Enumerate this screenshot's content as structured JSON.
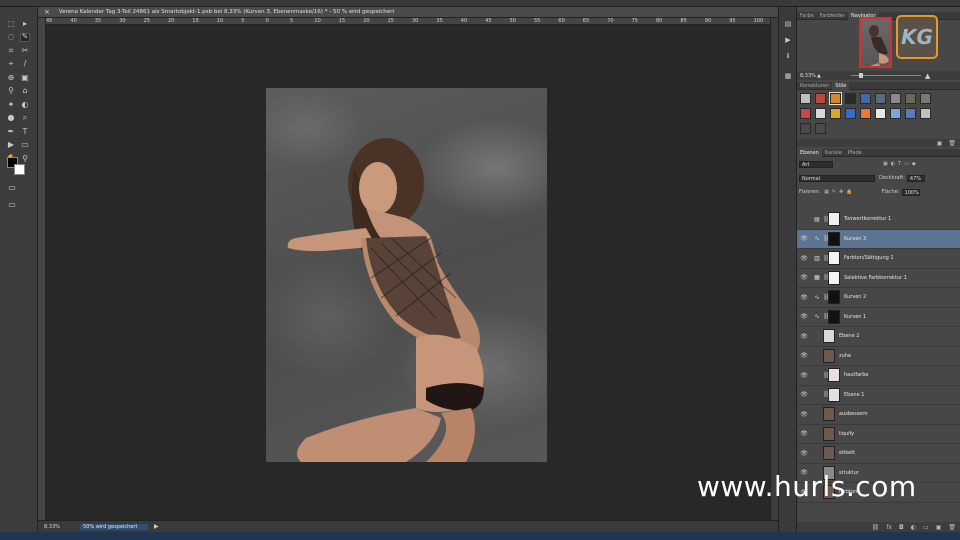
{
  "document": {
    "tab_title": "Verena Kalender Tag 3-Teil 24861 als Smartobjekt-1.psb bei 8,33% (Kurven 3, Ebenenmaske/16) * - 50 % wird gespeichert",
    "close_glyph": "×"
  },
  "ruler_ticks": [
    "45",
    "40",
    "35",
    "30",
    "25",
    "20",
    "15",
    "10",
    "5",
    "0",
    "5",
    "10",
    "15",
    "20",
    "25",
    "30",
    "35",
    "40",
    "45",
    "50",
    "55",
    "60",
    "65",
    "70",
    "75",
    "80",
    "85",
    "90",
    "95",
    "100"
  ],
  "statusbar": {
    "zoom": "8,33%",
    "info": "50% wird gespeichert",
    "arrow_glyph": "▶"
  },
  "tools": [
    "⬚",
    "▸",
    "◌",
    "✎",
    "⌗",
    "✂",
    "⌖",
    "/",
    "⊕",
    "▣",
    "⚲",
    "⌂",
    "✦",
    "◐",
    "●",
    "⌕",
    "✒",
    "T",
    "▶",
    "▭",
    "✋",
    "⚲"
  ],
  "navigator_panel": {
    "tabs": [
      "Farbe",
      "Farbfelder",
      "Navigator"
    ],
    "active_tab": "Navigator",
    "zoom": "8,33%",
    "logo_text": "KG"
  },
  "styles_panel": {
    "tabs": [
      "Korrekturen",
      "Stile"
    ],
    "active_tab": "Stile",
    "swatch_colors": [
      "#c0c0c0",
      "#b84a3a",
      "#d48a2a",
      "#2a2a2a",
      "#3f6aa8",
      "#5a6a7a",
      "#8a8a8a",
      "#6a6a5a",
      "#7a7a6a",
      "#c84848",
      "#d8d8d8",
      "#d8a82a",
      "#3a6ac8",
      "#e87838",
      "#e8e8e8",
      "#7aa8d8",
      "#5a7ab8",
      "#c0c0c0",
      "#4a4a4a",
      "#4a4a4a"
    ]
  },
  "layers_panel": {
    "tabs": [
      "Ebenen",
      "Kanäle",
      "Pfade"
    ],
    "active_tab": "Ebenen",
    "filter": "Art",
    "blend_mode": "Normal",
    "opacity_label": "Deckkraft:",
    "opacity_value": "47%",
    "lock_label": "Fixieren:",
    "fill_label": "Fläche:",
    "fill_value": "100%",
    "layers": [
      {
        "name": "Tonwertkorrektur 1",
        "adj": "▤",
        "thumb": "#f0f0f0",
        "mask": true,
        "visible": false,
        "selected": false
      },
      {
        "name": "Kurven 3",
        "adj": "∿",
        "thumb": "#111111",
        "mask": true,
        "visible": true,
        "selected": true
      },
      {
        "name": "Farbton/Sättigung 1",
        "adj": "▥",
        "thumb": "#f4f4f4",
        "mask": true,
        "visible": true,
        "selected": false
      },
      {
        "name": "Selektive Farbkorrektur 1",
        "adj": "▦",
        "thumb": "#f4f4f4",
        "mask": true,
        "visible": true,
        "selected": false
      },
      {
        "name": "Kurven 2",
        "adj": "∿",
        "thumb": "#111111",
        "mask": true,
        "visible": true,
        "selected": false
      },
      {
        "name": "Kurven 1",
        "adj": "∿",
        "thumb": "#111111",
        "mask": true,
        "visible": true,
        "selected": false
      },
      {
        "name": "Ebene 2",
        "adj": "",
        "thumb": "#d8d8d8",
        "mask": false,
        "visible": true,
        "selected": false
      },
      {
        "name": "zuhe",
        "adj": "",
        "thumb": "#6a5a50",
        "mask": false,
        "visible": true,
        "selected": false
      },
      {
        "name": "hautfarbe",
        "adj": "",
        "thumb": "#e8e0dc",
        "mask": true,
        "visible": true,
        "selected": false
      },
      {
        "name": "Ebene 1",
        "adj": "",
        "thumb": "#e0e0e0",
        "mask": true,
        "visible": true,
        "selected": false
      },
      {
        "name": "ausbessern",
        "adj": "",
        "thumb": "#6a5a50",
        "mask": false,
        "visible": true,
        "selected": false
      },
      {
        "name": "liquify",
        "adj": "",
        "thumb": "#6a5a50",
        "mask": false,
        "visible": true,
        "selected": false
      },
      {
        "name": "etikett",
        "adj": "",
        "thumb": "#6a5a50",
        "mask": false,
        "visible": true,
        "selected": false
      },
      {
        "name": "struktur",
        "adj": "",
        "thumb": "#8a8a8a",
        "mask": false,
        "visible": true,
        "selected": false
      },
      {
        "name": "farbton",
        "adj": "",
        "thumb": "#6a5a50",
        "mask": false,
        "visible": true,
        "selected": false
      }
    ]
  },
  "watermark": "www.hurls.com"
}
